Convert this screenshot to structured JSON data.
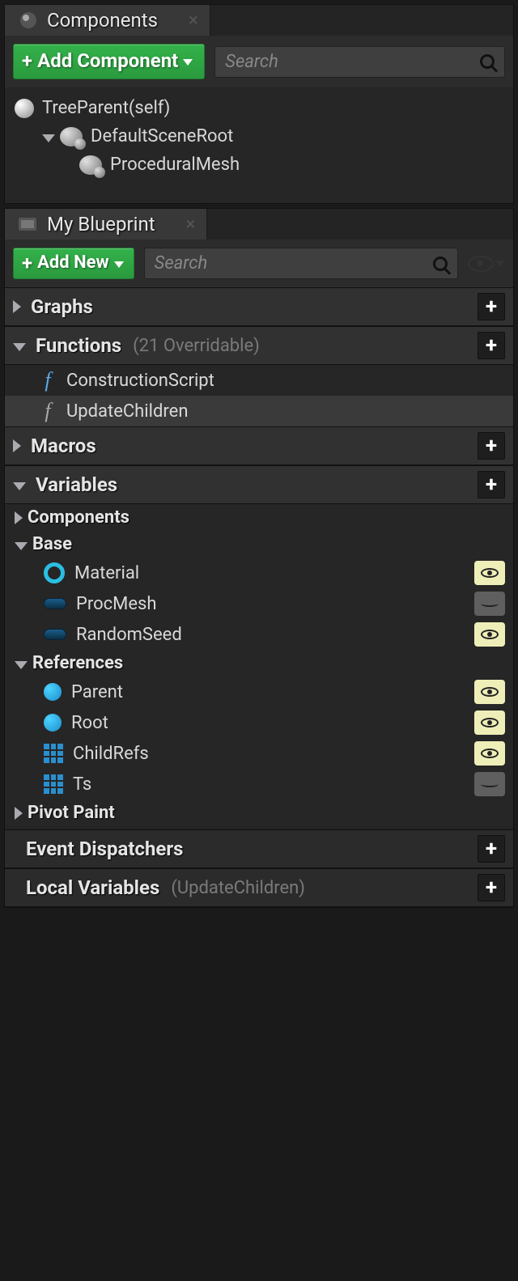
{
  "components": {
    "panel_title": "Components",
    "add_button": "Add Component",
    "search_placeholder": "Search",
    "tree": {
      "root": "TreeParent(self)",
      "scene_root": "DefaultSceneRoot",
      "child": "ProceduralMesh"
    }
  },
  "blueprint": {
    "panel_title": "My Blueprint",
    "add_button": "Add New",
    "search_placeholder": "Search",
    "sections": {
      "graphs": "Graphs",
      "functions": {
        "title": "Functions",
        "subtitle": "(21 Overridable)",
        "items": [
          {
            "name": "ConstructionScript"
          },
          {
            "name": "UpdateChildren"
          }
        ]
      },
      "macros": "Macros",
      "variables": {
        "title": "Variables",
        "components": "Components",
        "base": {
          "title": "Base",
          "items": [
            {
              "name": "Material",
              "icon": "ring",
              "visible": true
            },
            {
              "name": "ProcMesh",
              "icon": "pill",
              "visible": false
            },
            {
              "name": "RandomSeed",
              "icon": "pill",
              "visible": true
            }
          ]
        },
        "references": {
          "title": "References",
          "items": [
            {
              "name": "Parent",
              "icon": "dot",
              "visible": true
            },
            {
              "name": "Root",
              "icon": "dot",
              "visible": true
            },
            {
              "name": "ChildRefs",
              "icon": "grid",
              "visible": true
            },
            {
              "name": "Ts",
              "icon": "grid",
              "visible": false
            }
          ]
        },
        "pivot_paint": "Pivot Paint"
      },
      "event_dispatchers": "Event Dispatchers",
      "local_variables": {
        "title": "Local Variables",
        "subtitle": "(UpdateChildren)"
      }
    }
  }
}
